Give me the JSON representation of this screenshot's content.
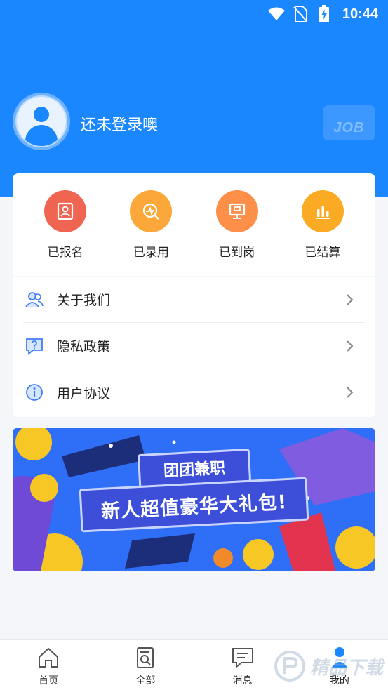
{
  "status_bar": {
    "time": "10:44"
  },
  "profile": {
    "login_text": "还未登录噢",
    "badge_text": "JOB"
  },
  "status_items": [
    {
      "label": "已报名",
      "icon": "id-card-icon",
      "color": "#f06452"
    },
    {
      "label": "已录用",
      "icon": "chart-search-icon",
      "color": "#fba73a"
    },
    {
      "label": "已到岗",
      "icon": "monitor-icon",
      "color": "#fd8f48"
    },
    {
      "label": "已结算",
      "icon": "bar-chart-icon",
      "color": "#fbaa24"
    }
  ],
  "menu": [
    {
      "label": "关于我们",
      "icon": "users-icon"
    },
    {
      "label": "隐私政策",
      "icon": "question-chat-icon"
    },
    {
      "label": "用户协议",
      "icon": "info-icon"
    }
  ],
  "banner": {
    "title": "团团兼职",
    "subtitle": "新人超值豪华大礼包!"
  },
  "bottom_nav": [
    {
      "label": "首页",
      "icon": "home-icon"
    },
    {
      "label": "全部",
      "icon": "document-search-icon"
    },
    {
      "label": "消息",
      "icon": "message-icon"
    },
    {
      "label": "我的",
      "icon": "user-icon",
      "active": true
    }
  ],
  "watermark": {
    "text": "精品下载"
  },
  "colors": {
    "primary": "#1a87ff",
    "background": "#f4f6fa"
  }
}
